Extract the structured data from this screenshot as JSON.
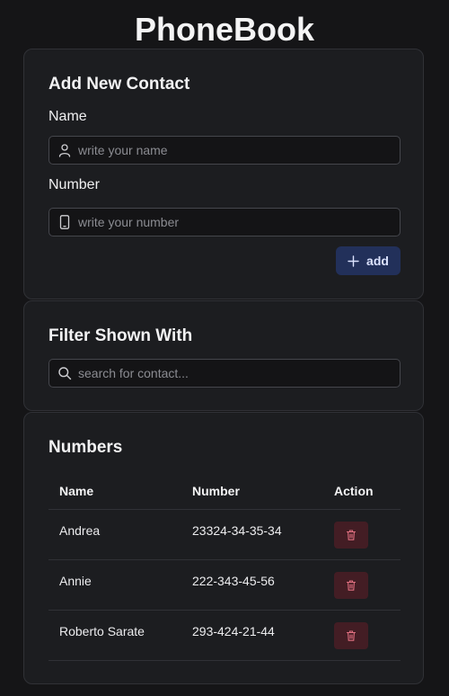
{
  "app": {
    "title": "PhoneBook"
  },
  "add_contact": {
    "heading": "Add New Contact",
    "name_label": "Name",
    "name_placeholder": "write your name",
    "name_value": "",
    "number_label": "Number",
    "number_placeholder": "write your number",
    "number_value": "",
    "add_label": "add"
  },
  "filter": {
    "heading": "Filter Shown With",
    "search_placeholder": "search for contact...",
    "search_value": ""
  },
  "numbers": {
    "heading": "Numbers",
    "columns": [
      "Name",
      "Number",
      "Action"
    ],
    "rows": [
      {
        "name": "Andrea",
        "number": "23324-34-35-34"
      },
      {
        "name": "Annie",
        "number": "222-343-45-56"
      },
      {
        "name": "Roberto Sarate",
        "number": "293-424-21-44"
      }
    ]
  },
  "icons": {
    "name_field": "user-icon",
    "number_field": "phone-icon",
    "search_field": "search-icon",
    "add": "plus-icon",
    "delete": "trash-icon"
  },
  "colors": {
    "background": "#151517",
    "card": "#1c1d20",
    "add_button": "#22305a",
    "delete_button": "#431d24",
    "delete_icon": "#e07080"
  }
}
